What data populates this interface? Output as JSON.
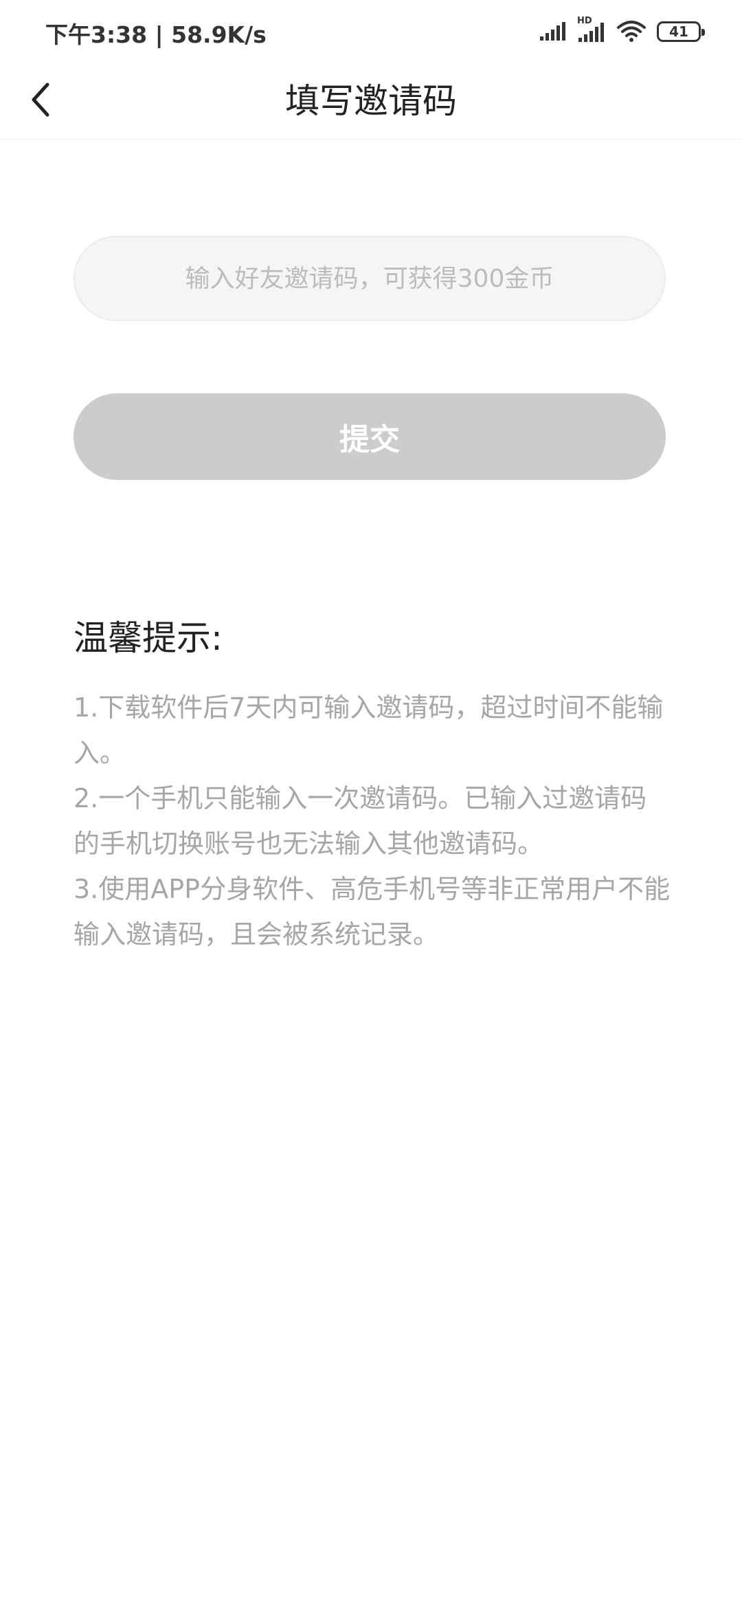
{
  "status_bar": {
    "time_and_speed": "下午3:38 | 58.9K/s",
    "network_badge": "HD",
    "battery_level": "41"
  },
  "header": {
    "title": "填写邀请码",
    "back_icon": "chevron-left-icon"
  },
  "form": {
    "input_placeholder": "输入好友邀请码，可获得300金币",
    "input_value": "",
    "submit_label": "提交"
  },
  "tips": {
    "title": "温馨提示:",
    "items": [
      "1.下载软件后7天内可输入邀请码，超过时间不能输入。",
      "2.一个手机只能输入一次邀请码。已输入过邀请码的手机切换账号也无法输入其他邀请码。",
      "3.使用APP分身软件、高危手机号等非正常用户不能输入邀请码，且会被系统记录。"
    ]
  },
  "colors": {
    "button_disabled": "#cccccc",
    "input_background": "#f5f5f5",
    "tip_text": "#a6a6a6",
    "title_text": "#222222"
  }
}
